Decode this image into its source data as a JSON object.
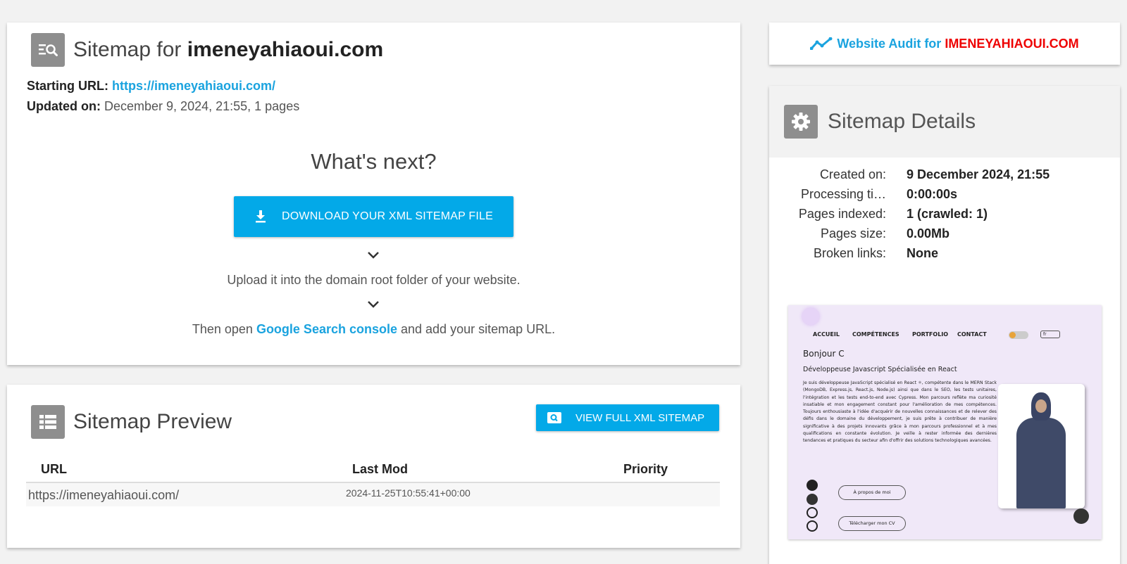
{
  "sitemap": {
    "title_prefix": "Sitemap for ",
    "domain": "imeneyahiaoui.com",
    "starting_url_label": "Starting URL:",
    "starting_url": "https://imeneyahiaoui.com/",
    "updated_label": "Updated on:",
    "updated_value": "December 9, 2024, 21:55, 1 pages",
    "whats_next": "What's next?",
    "download_label": "DOWNLOAD YOUR XML SITEMAP FILE",
    "upload_text": "Upload it into the domain root folder of your website.",
    "then_open": "Then open ",
    "console_link": "Google Search console",
    "then_rest": " and add your sitemap URL."
  },
  "preview": {
    "title": "Sitemap Preview",
    "view_full_label": "VIEW FULL XML SITEMAP",
    "columns": [
      "URL",
      "Last Mod",
      "Priority"
    ],
    "rows": [
      {
        "url": "https://imeneyahiaoui.com/",
        "lastmod": "2024-11-25T10:55:41+00:00",
        "priority": ""
      }
    ]
  },
  "audit": {
    "label": "Website Audit for",
    "domain": "IMENEYAHIAOUI.COM",
    "accent": "#1aa3df",
    "domain_color": "#ee0000"
  },
  "details": {
    "title": "Sitemap Details",
    "rows": [
      {
        "label": "Created on:",
        "value": "9 December 2024, 21:55"
      },
      {
        "label": "Processing ti…",
        "value": "0:00:00s"
      },
      {
        "label": "Pages indexed:",
        "value": "1 (crawled: 1)"
      },
      {
        "label": "Pages size:",
        "value": "0.00Mb"
      },
      {
        "label": "Broken links:",
        "value": "None"
      }
    ]
  },
  "thumbnail": {
    "nav": [
      "ACCUEIL",
      "COMPÉTENCES",
      "PORTFOLIO",
      "CONTACT"
    ],
    "lang": "fr",
    "greeting": "Bonjour C",
    "role": "Développeuse Javascript Spécialisée en React",
    "paragraph": "Je suis développeuse JavaScript spécialisé en React ⚛, compétente dans le MERN Stack (MongoDB, Express.js, React.js, Node.js) ainsi que dans le SEO, les tests unitaires, l'intégration et les tests end-to-end avec Cypress. Mon parcours reflète ma curiosité insatiable et mon engagement constant pour l'amélioration de mes compétences. Toujours enthousiaste à l'idée d'acquérir de nouvelles connaissances et de relever des défis dans le domaine du développement, je suis prête à contribuer de manière significative à des projets innovants grâce à mon parcours professionnel et à mes qualifications en constante évolution. Je veille à rester informée des dernières tendances et pratiques du secteur afin d'offrir des solutions technologiques avancées.",
    "about_button": "À propos de moi",
    "cv_button": "Télécharger mon CV"
  },
  "colors": {
    "primary_button": "#03a9e8",
    "link": "#1aa3df",
    "icon_box": "#8e8e8e"
  }
}
